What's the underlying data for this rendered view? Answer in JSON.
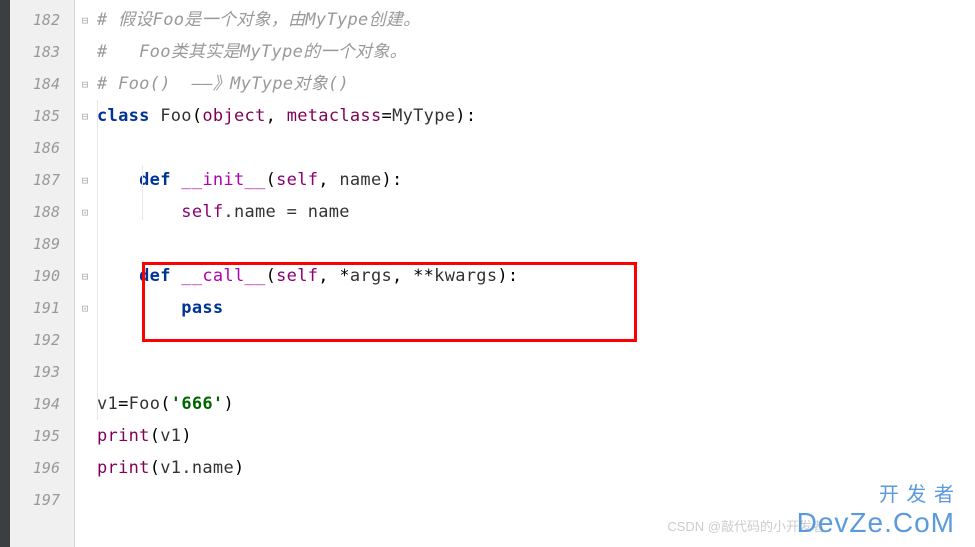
{
  "line_numbers": [
    "182",
    "183",
    "184",
    "185",
    "186",
    "187",
    "188",
    "189",
    "190",
    "191",
    "192",
    "193",
    "194",
    "195",
    "196",
    "197"
  ],
  "fold_markers": [
    "⊟",
    "",
    "⊟",
    "⊟",
    "",
    "⊟",
    "⊡",
    "",
    "⊟",
    "⊡",
    "",
    "",
    "",
    "",
    "",
    ""
  ],
  "code": {
    "l182": {
      "comment": "# 假设Foo是一个对象，由MyType创建。"
    },
    "l183": {
      "comment": "#   Foo类其实是MyType的一个对象。"
    },
    "l184": {
      "comment": "# Foo()  ——》MyType对象()"
    },
    "l185": {
      "kw1": "class",
      "sp": " ",
      "cls": "Foo",
      "p1": "(",
      "base": "object",
      "comma": ", ",
      "meta_kw": "metaclass",
      "eq": "=",
      "meta": "MyType",
      "p2": "):"
    },
    "l186": {
      "empty": ""
    },
    "l187": {
      "indent": "    ",
      "kw": "def",
      "sp": " ",
      "fn": "__init__",
      "p1": "(",
      "self": "self",
      "comma": ", ",
      "param": "name",
      "p2": "):"
    },
    "l188": {
      "indent": "        ",
      "self": "self",
      "dot": ".name = name"
    },
    "l189": {
      "empty": ""
    },
    "l190": {
      "indent": "    ",
      "kw": "def",
      "sp": " ",
      "fn": "__call__",
      "p1": "(",
      "self": "self",
      "c1": ", *",
      "args": "args",
      "c2": ", **",
      "kw2": "kwargs",
      "p2": "):"
    },
    "l191": {
      "indent": "        ",
      "kw": "pass"
    },
    "l192": {
      "empty": ""
    },
    "l193": {
      "empty": ""
    },
    "l194": {
      "var": "v1",
      "eq": "=",
      "cls": "Foo",
      "p1": "(",
      "str": "'666'",
      "p2": ")"
    },
    "l195": {
      "fn": "print",
      "p1": "(",
      "arg": "v1",
      "p2": ")"
    },
    "l196": {
      "fn": "print",
      "p1": "(",
      "arg": "v1.name",
      "p2": ")"
    },
    "l197": {
      "empty": ""
    }
  },
  "watermark_cn": "开 发 者",
  "watermark_en": "DevZe.CoM",
  "watermark_csdn": "CSDN @敲代码的小开发者"
}
